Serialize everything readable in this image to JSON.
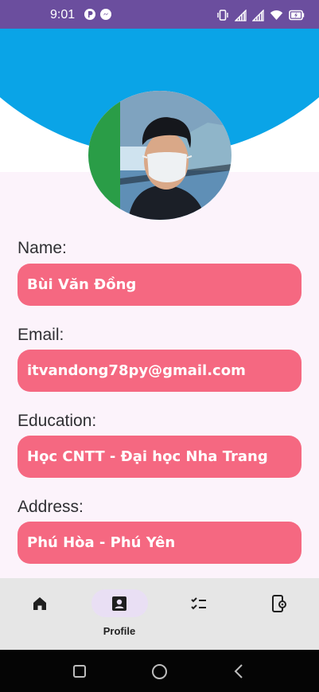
{
  "status_bar": {
    "time": "9:01",
    "left_icons": [
      "app-notification-icon",
      "messenger-icon"
    ],
    "right_icons": [
      "vibrate-icon",
      "signal-icon",
      "signal-icon",
      "wifi-icon",
      "battery-charging-icon"
    ]
  },
  "colors": {
    "status_bar": "#6b4e9e",
    "header_blue": "#0aa4e7",
    "field_background": "#f56881",
    "field_text": "#ffffff",
    "page_background": "#fcf3fb",
    "nav_background": "#e6e6e6",
    "nav_active_pill": "#e9dff4"
  },
  "profile": {
    "avatar": "profile-photo",
    "fields": [
      {
        "label": "Name:",
        "value": "Bùi Văn Đồng"
      },
      {
        "label": "Email:",
        "value": "itvandong78py@gmail.com"
      },
      {
        "label": "Education:",
        "value": "Học CNTT - Đại học Nha Trang"
      },
      {
        "label": "Address:",
        "value": "Phú Hòa - Phú Yên"
      }
    ]
  },
  "bottom_nav": {
    "items": [
      {
        "icon": "home-icon",
        "label": ""
      },
      {
        "icon": "profile-icon",
        "label": "Profile",
        "active": true
      },
      {
        "icon": "checklist-icon",
        "label": ""
      },
      {
        "icon": "device-settings-icon",
        "label": ""
      }
    ]
  },
  "system_nav": {
    "buttons": [
      "recents-button",
      "home-button",
      "back-button"
    ]
  }
}
